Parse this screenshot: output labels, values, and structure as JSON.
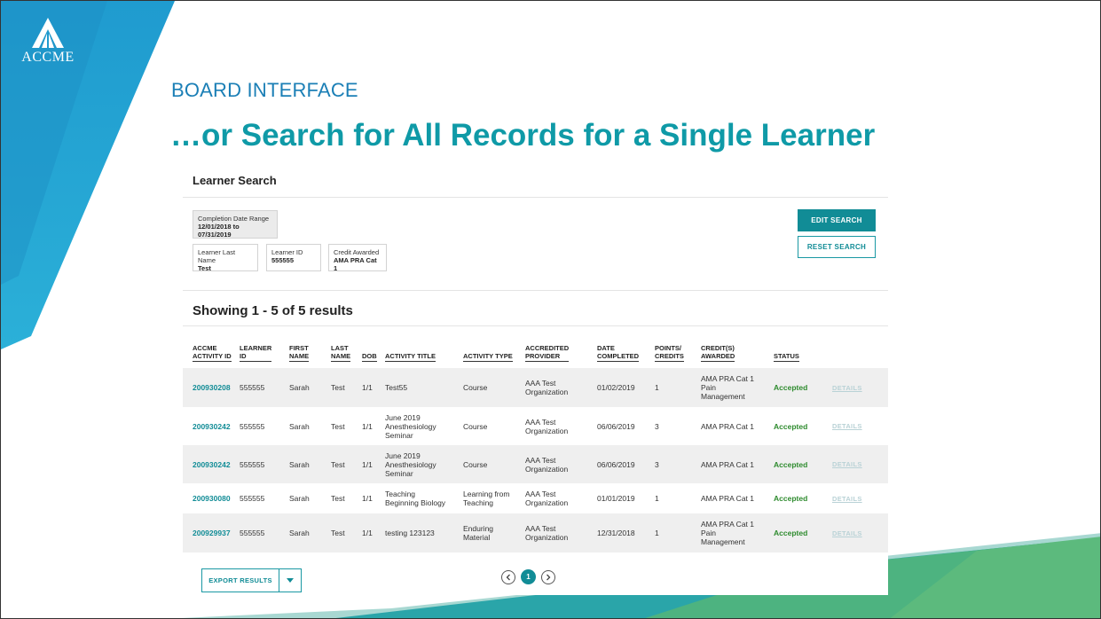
{
  "brand": {
    "logo_text": "ACCME"
  },
  "slide": {
    "kicker": "BOARD INTERFACE",
    "headline": "…or Search for All Records for a Single Learner"
  },
  "panel": {
    "title": "Learner Search",
    "filters": {
      "date_range": {
        "label": "Completion Date Range",
        "value": "12/01/2018 to 07/31/2019"
      },
      "last_name": {
        "label": "Learner Last Name",
        "value": "Test"
      },
      "learner_id": {
        "label": "Learner ID",
        "value": "555555"
      },
      "credit": {
        "label": "Credit Awarded",
        "value": "AMA PRA Cat 1"
      }
    },
    "buttons": {
      "edit_search": "EDIT SEARCH",
      "reset_search": "RESET SEARCH"
    },
    "results_count": "Showing 1 - 5 of 5 results",
    "table": {
      "columns": [
        {
          "line1": "ACCME",
          "line2": "ACTIVITY ID"
        },
        {
          "line1": "LEARNER",
          "line2": "ID"
        },
        {
          "line1": "FIRST",
          "line2": "NAME"
        },
        {
          "line1": "LAST",
          "line2": "NAME"
        },
        {
          "line1": "",
          "line2": "DOB"
        },
        {
          "line1": "",
          "line2": "ACTIVITY TITLE"
        },
        {
          "line1": "",
          "line2": "ACTIVITY TYPE"
        },
        {
          "line1": "ACCREDITED",
          "line2": "PROVIDER"
        },
        {
          "line1": "DATE",
          "line2": "COMPLETED"
        },
        {
          "line1": "POINTS/",
          "line2": "CREDITS"
        },
        {
          "line1": "CREDIT(S)",
          "line2": "AWARDED"
        },
        {
          "line1": "",
          "line2": "STATUS"
        },
        {
          "line1": "",
          "line2": ""
        }
      ],
      "rows": [
        {
          "activity_id": "200930208",
          "learner_id": "555555",
          "first": "Sarah",
          "last": "Test",
          "dob": "1/1",
          "title": [
            "Test55"
          ],
          "type": [
            "Course"
          ],
          "provider": [
            "AAA Test",
            "Organization"
          ],
          "date": "01/02/2019",
          "points": "1",
          "credits": [
            "AMA PRA Cat 1",
            "Pain",
            "Management"
          ],
          "status": "Accepted",
          "details": "DETAILS"
        },
        {
          "activity_id": "200930242",
          "learner_id": "555555",
          "first": "Sarah",
          "last": "Test",
          "dob": "1/1",
          "title": [
            "June 2019",
            "Anesthesiology",
            "Seminar"
          ],
          "type": [
            "Course"
          ],
          "provider": [
            "AAA Test",
            "Organization"
          ],
          "date": "06/06/2019",
          "points": "3",
          "credits": [
            "AMA PRA Cat 1"
          ],
          "status": "Accepted",
          "details": "DETAILS"
        },
        {
          "activity_id": "200930242",
          "learner_id": "555555",
          "first": "Sarah",
          "last": "Test",
          "dob": "1/1",
          "title": [
            "June 2019",
            "Anesthesiology",
            "Seminar"
          ],
          "type": [
            "Course"
          ],
          "provider": [
            "AAA Test",
            "Organization"
          ],
          "date": "06/06/2019",
          "points": "3",
          "credits": [
            "AMA PRA Cat 1"
          ],
          "status": "Accepted",
          "details": "DETAILS"
        },
        {
          "activity_id": "200930080",
          "learner_id": "555555",
          "first": "Sarah",
          "last": "Test",
          "dob": "1/1",
          "title": [
            "Teaching",
            "Beginning Biology"
          ],
          "type": [
            "Learning from",
            "Teaching"
          ],
          "provider": [
            "AAA Test",
            "Organization"
          ],
          "date": "01/01/2019",
          "points": "1",
          "credits": [
            "AMA PRA Cat 1"
          ],
          "status": "Accepted",
          "details": "DETAILS"
        },
        {
          "activity_id": "200929937",
          "learner_id": "555555",
          "first": "Sarah",
          "last": "Test",
          "dob": "1/1",
          "title": [
            "testing 123123"
          ],
          "type": [
            "Enduring",
            "Material"
          ],
          "provider": [
            "AAA Test",
            "Organization"
          ],
          "date": "12/31/2018",
          "points": "1",
          "credits": [
            "AMA PRA Cat 1",
            "Pain",
            "Management"
          ],
          "status": "Accepted",
          "details": "DETAILS"
        }
      ]
    },
    "export_label": "EXPORT RESULTS",
    "pagination": {
      "current_page": "1"
    }
  }
}
